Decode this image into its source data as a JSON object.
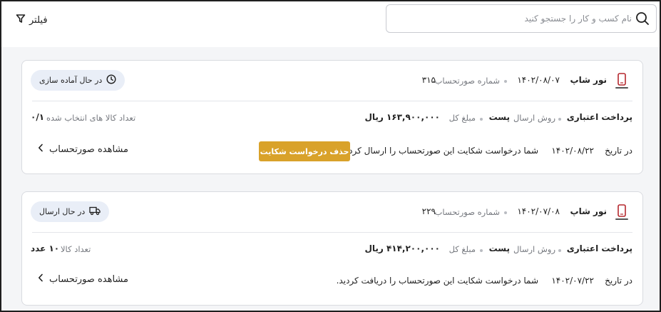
{
  "search": {
    "placeholder": "نام کسب و کار را جستجو کنید",
    "value": ""
  },
  "filter": {
    "label": "فیلتر"
  },
  "cards": [
    {
      "store_name": "نور شاپ",
      "date": "۱۴۰۲/۰۸/۰۷",
      "invoice_label": "شماره صورتحساب",
      "invoice_number": "۳۱۵",
      "status": "در حال آماده سازی",
      "status_icon": "clock-icon",
      "payment": "پرداخت اعتباری",
      "shipping_label": "روش ارسال",
      "shipping_value": "پست",
      "amount_label": "مبلغ کل",
      "amount_value": "۱۶۳,۹۰۰,۰۰۰ ریال",
      "items_label": "تعداد کالا های انتخاب شده",
      "items_value": "۰/۱",
      "message_prefix": "در تاریخ",
      "message_date": "۱۴۰۲/۰۸/۲۲",
      "message_text": "شما درخواست شکایت این صورتحساب را ارسال کردید.",
      "action_button": "حذف درخواست شکایت",
      "view_link": "مشاهده صورتحساب"
    },
    {
      "store_name": "نور شاپ",
      "date": "۱۴۰۲/۰۷/۰۸",
      "invoice_label": "شماره صورتحساب",
      "invoice_number": "۲۲۹",
      "status": "در حال ارسال",
      "status_icon": "truck-icon",
      "payment": "پرداخت اعتباری",
      "shipping_label": "روش ارسال",
      "shipping_value": "پست",
      "amount_label": "مبلغ کل",
      "amount_value": "۴۱۴,۲۰۰,۰۰۰ ریال",
      "items_label": "تعداد کالا",
      "items_value": "۱۰ عدد",
      "message_prefix": "در تاریخ",
      "message_date": "۱۴۰۲/۰۷/۲۲",
      "message_text": "شما درخواست شکایت این صورتحساب را دریافت کردید.",
      "view_link": "مشاهده صورتحساب"
    }
  ],
  "colors": {
    "accent": "#d9a22a",
    "badge_bg": "#e9eef7",
    "page_bg": "#f4f5f7"
  }
}
